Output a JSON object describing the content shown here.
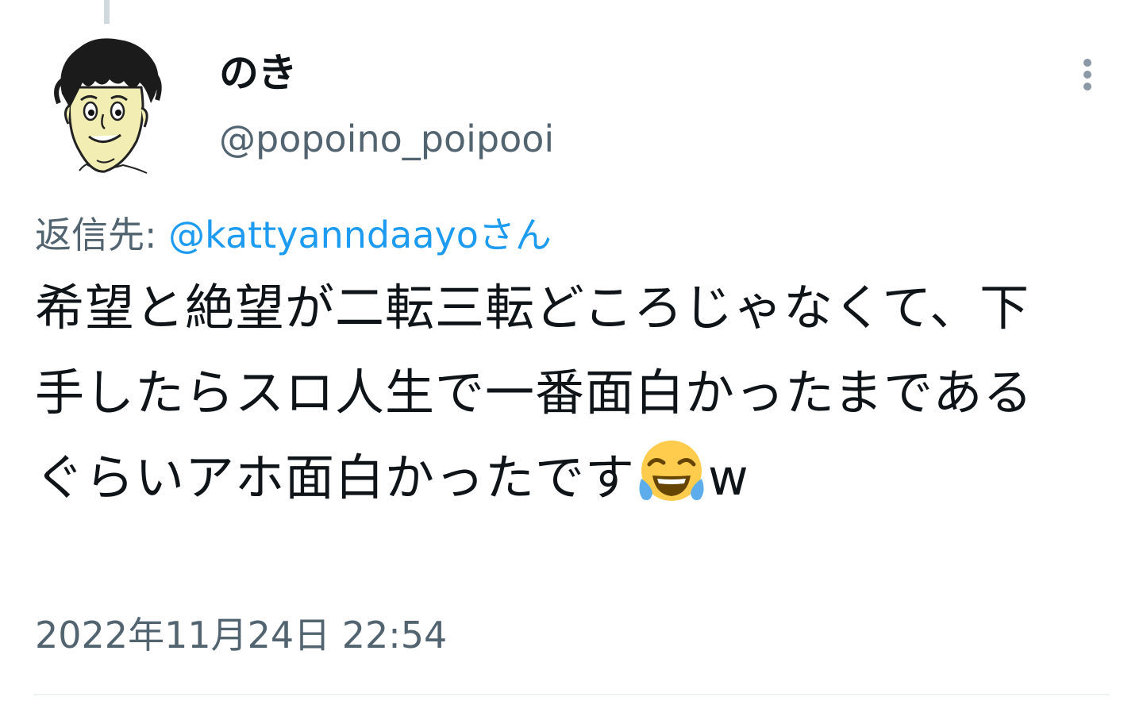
{
  "author": {
    "display_name": "のき",
    "handle": "@popoino_poipooi",
    "avatar_icon": "avatar-cartoon-face-icon"
  },
  "more_icon": "more-vertical-icon",
  "reply": {
    "prefix": "返信先:",
    "mention": "@kattyanndaayoさん"
  },
  "tweet": {
    "text_before_emoji": "希望と絶望が二転三転どころじゃなくて、下手したらスロ人生で一番面白かったまであるぐらいアホ面白かったです",
    "emoji_icon": "face-with-tears-of-joy-icon",
    "text_after_emoji": "w"
  },
  "timestamp": "2022年11月24日 22:54",
  "colors": {
    "primary_text": "#0f1419",
    "secondary_text": "#536471",
    "link": "#1d9bf0",
    "divider": "#eff3f4",
    "thread_line": "#cfd9de"
  }
}
